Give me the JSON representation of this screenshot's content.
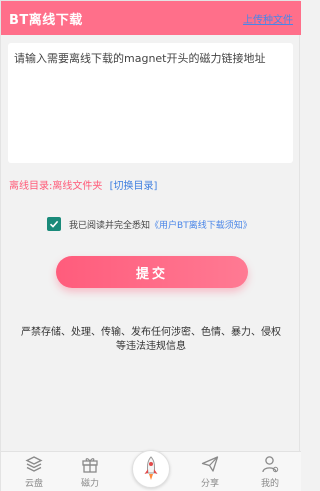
{
  "header": {
    "title": "BT离线下载",
    "link": "上传种文件"
  },
  "input": {
    "placeholder": "请输入需要离线下载的magnet开头的磁力链接地址"
  },
  "directory": {
    "label": "离线目录:离线文件夹",
    "switch": "[切换目录]"
  },
  "agreement": {
    "checked": true,
    "text": "我已阅读并完全悉知",
    "link": "《用户BT离线下载须知》"
  },
  "submit": {
    "label": "提交"
  },
  "notice": {
    "line1": "严禁存储、处理、传输、发布任何涉密、色情、暴力、侵权",
    "line2": "等违法违规信息"
  },
  "nav": {
    "items": [
      {
        "label": "云盘",
        "icon": "stack-icon"
      },
      {
        "label": "磁力",
        "icon": "gift-icon"
      },
      {
        "label": "",
        "icon": "rocket-icon"
      },
      {
        "label": "分享",
        "icon": "paper-plane-icon"
      },
      {
        "label": "我的",
        "icon": "user-icon"
      }
    ]
  },
  "colors": {
    "brand": "#ff6f8a",
    "link": "#4a86e8",
    "checkbox": "#1a8a7a"
  }
}
